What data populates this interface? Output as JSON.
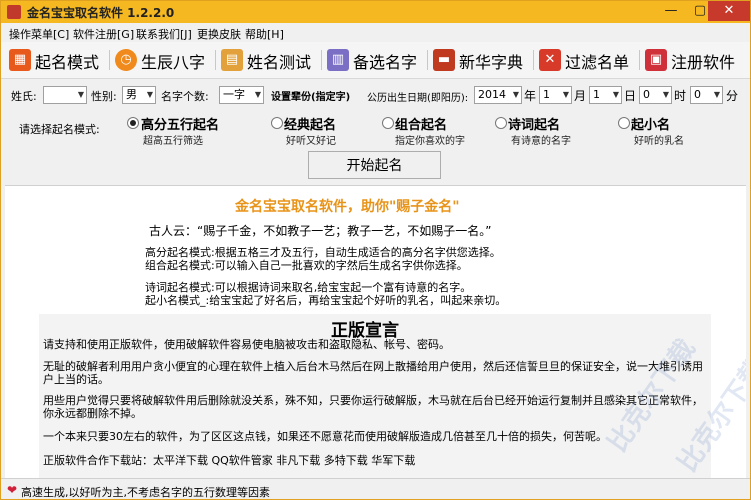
{
  "window": {
    "title": "金名宝宝取名软件 1.2.2.0",
    "minimize": "—",
    "maximize": "▢",
    "close": "✕"
  },
  "menu": [
    "操作菜单[C]",
    "软件注册[G]",
    "联系我们[J]",
    "更换皮肤",
    "帮助[H]"
  ],
  "toolbar": [
    {
      "label": "起名模式",
      "icon": "grid-icon",
      "color": "#e85a1c",
      "glyph": "▦"
    },
    {
      "label": "生辰八字",
      "icon": "clock-icon",
      "color": "#f08a1c",
      "glyph": "◷"
    },
    {
      "label": "姓名测试",
      "icon": "calculator-icon",
      "color": "#e2a13a",
      "glyph": "▤"
    },
    {
      "label": "备选名字",
      "icon": "calendar-icon",
      "color": "#7a6fc4",
      "glyph": "▥"
    },
    {
      "label": "新华字典",
      "icon": "book-icon",
      "color": "#c03a20",
      "glyph": "▬"
    },
    {
      "label": "过滤名单",
      "icon": "filter-icon",
      "color": "#d83a2a",
      "glyph": "✕"
    },
    {
      "label": "注册软件",
      "icon": "lock-icon",
      "color": "#d0303a",
      "glyph": "▣"
    }
  ],
  "form": {
    "surname_label": "姓氏:",
    "surname_value": "",
    "gender_label": "性别:",
    "gender_value": "男",
    "namecount_label": "名字个数:",
    "namecount_value": "一字",
    "set_label": "设置辈份(指定字)",
    "birth_label": "公历出生日期(即阳历):",
    "year_value": "2014",
    "year_unit": "年",
    "month_value": "1",
    "month_unit": "月",
    "day_value": "1",
    "day_unit": "日",
    "hour_value": "0",
    "hour_unit": "时",
    "minute_value": "0",
    "minute_unit": "分"
  },
  "modes": {
    "label": "请选择起名模式:",
    "options": [
      {
        "name": "高分五行起名",
        "desc": "超高五行筛选",
        "selected": true
      },
      {
        "name": "经典起名",
        "desc": "好听又好记",
        "selected": false
      },
      {
        "name": "组合起名",
        "desc": "指定你喜欢的字",
        "selected": false
      },
      {
        "name": "诗词起名",
        "desc": "有诗意的名字",
        "selected": false
      },
      {
        "name": "起小名",
        "desc": "好听的乳名",
        "selected": false
      }
    ]
  },
  "start_button": "开始起名",
  "content": {
    "slogan": "金名宝宝取名软件，助你\"赐子金名\"",
    "quote": "古人云：“赐子千金，不如教子一艺；教子一艺，不如赐子一名。”",
    "descriptions": [
      "高分起名模式:根据五格三才及五行，自动生成适合的高分名字供您选择。",
      "组合起名模式:可以输入自己一批喜欢的字然后生成名字供你选择。",
      "诗词起名模式:可以根据诗词来取名,给宝宝起一个富有诗意的名字。",
      "起小名模式_:给宝宝起了好名后，再给宝宝起个好听的乳名，叫起来亲切。"
    ],
    "notice_title": "正版宣言",
    "notice_paragraphs": [
      "请支持和使用正版软件，使用破解软件容易使电脑被攻击和盗取隐私、帐号、密码。",
      "无耻的破解者利用用户贪小便宜的心理在软件上植入后台木马然后在网上散播给用户使用，然后还信誓旦旦的保证安全，说一大堆引诱用户上当的话。",
      "用些用户觉得只要将破解软件用后删除就没关系，殊不知，只要你运行破解版，木马就在后台已经开始运行复制并且感染其它正常软件，你永远都删除不掉。",
      "一个本来只要30左右的软件，为了区区这点钱，如果还不愿意花而使用破解版造成几倍甚至几十倍的损失，何苦呢。",
      "正版软件合作下载站：太平洋下载  QQ软件管家  非凡下载  多特下载  华军下载"
    ]
  },
  "status": {
    "text": "高速生成,以好听为主,不考虑名字的五行数理等因素"
  },
  "watermarks": [
    "比克尔下载",
    "比克尔下载"
  ]
}
